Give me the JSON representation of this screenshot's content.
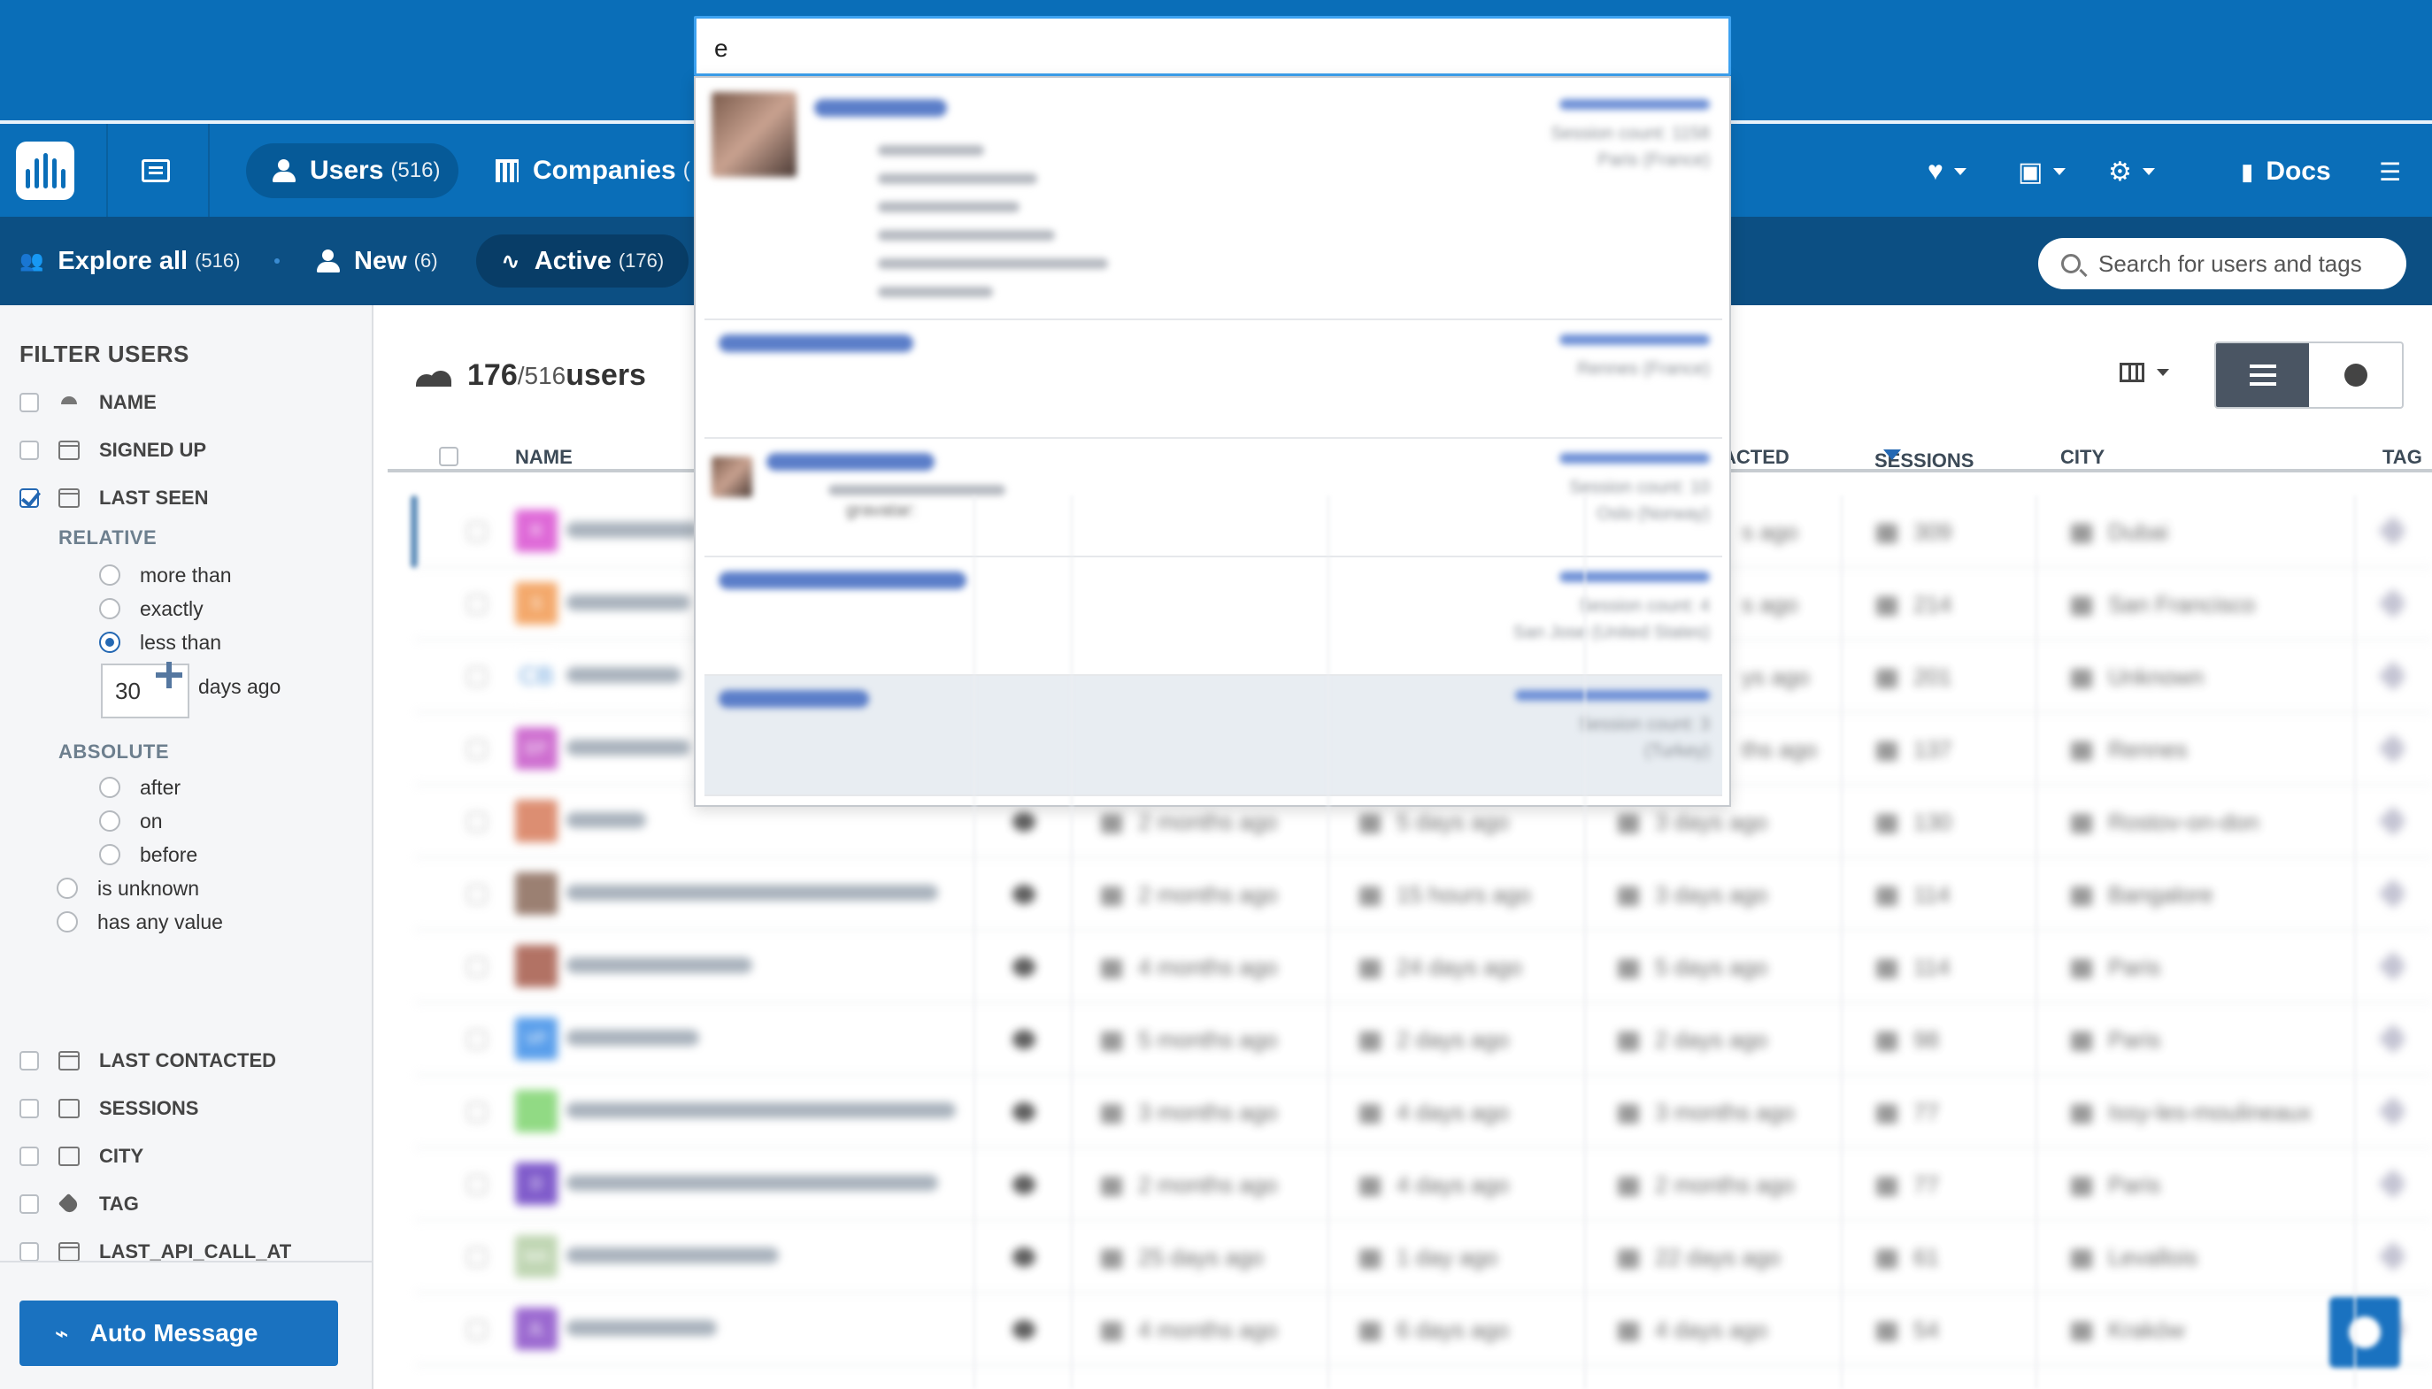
{
  "search": {
    "query": "e"
  },
  "nav": {
    "users_label": "Users",
    "users_count": "(516)",
    "companies_label": "Companies",
    "companies_count": "(",
    "docs_label": "Docs"
  },
  "subnav": {
    "explore_label": "Explore all",
    "explore_count": "(516)",
    "new_label": "New",
    "new_count": "(6)",
    "active_label": "Active",
    "active_count": "(176)",
    "search_placeholder": "Search for users and tags"
  },
  "sidebar": {
    "title": "FILTER USERS",
    "filters_top": [
      "NAME",
      "SIGNED UP",
      "LAST SEEN"
    ],
    "relative_label": "RELATIVE",
    "relative_options": [
      "more than",
      "exactly",
      "less than"
    ],
    "days_value": "30",
    "days_suffix": "days ago",
    "absolute_label": "ABSOLUTE",
    "absolute_options": [
      "after",
      "on",
      "before"
    ],
    "extra_options": [
      "is unknown",
      "has any value"
    ],
    "filters_bottom": [
      "LAST CONTACTED",
      "SESSIONS",
      "CITY",
      "TAG",
      "LAST_API_CALL_AT"
    ],
    "auto_message": "Auto Message"
  },
  "main": {
    "count_main": "176",
    "count_total": "/516",
    "count_suffix": " users",
    "columns": {
      "name": "NAME",
      "contacted": "ACTED",
      "sessions": "SESSIONS",
      "city": "CITY",
      "tag": "TAG"
    }
  },
  "rows": [
    {
      "av": "R",
      "avc": "#d94fd1",
      "c1": "",
      "c2": "",
      "c3": "s ago",
      "s": "309",
      "city": "Dubai"
    },
    {
      "av": "S",
      "avc": "#f29a52",
      "c1": "",
      "c2": "",
      "c3": "s ago",
      "s": "214",
      "city": "San Francisco"
    },
    {
      "av": "CB",
      "avc": "#ffffff",
      "c1": "",
      "c2": "",
      "c3": "ys ago",
      "s": "201",
      "city": "Unknown"
    },
    {
      "av": "EP",
      "avc": "#c656c8",
      "c1": "",
      "c2": "",
      "c3": "ths ago",
      "s": "137",
      "city": "Rennes"
    },
    {
      "av": "",
      "avc": "#d77b5a",
      "c1": "2 months ago",
      "c2": "5 days ago",
      "c3": "3 days ago",
      "s": "130",
      "city": "Rostov-on-don"
    },
    {
      "av": "",
      "avc": "#8a6a5a",
      "c1": "2 months ago",
      "c2": "15 hours ago",
      "c3": "3 days ago",
      "s": "114",
      "city": "Bangalore"
    },
    {
      "av": "",
      "avc": "#a55a4a",
      "c1": "4 months ago",
      "c2": "24 days ago",
      "c3": "5 days ago",
      "s": "114",
      "city": "Paris"
    },
    {
      "av": "VP",
      "avc": "#3d8ee8",
      "c1": "5 months ago",
      "c2": "2 days ago",
      "c3": "2 days ago",
      "s": "98",
      "city": "Paris"
    },
    {
      "av": "",
      "avc": "#7ed46f",
      "c1": "3 months ago",
      "c2": "4 days ago",
      "c3": "3 months ago",
      "s": "77",
      "city": "Issy-les-moulineaux"
    },
    {
      "av": "D",
      "avc": "#6a3fc2",
      "c1": "2 months ago",
      "c2": "4 days ago",
      "c3": "2 months ago",
      "s": "77",
      "city": "Paris"
    },
    {
      "av": "MA",
      "avc": "#b5cfa6",
      "c1": "25 days ago",
      "c2": "1 day ago",
      "c3": "22 days ago",
      "s": "61",
      "city": "Levallois"
    },
    {
      "av": "JL",
      "avc": "#8a4fc8",
      "c1": "4 months ago",
      "c2": "6 days ago",
      "c3": "4 days ago",
      "s": "54",
      "city": "Kraków"
    }
  ],
  "dropdown": [
    {
      "meta": [
        "Session count: 1158",
        "Paris (France)"
      ],
      "sub": 6
    },
    {
      "meta": [
        "Rennes (France)"
      ],
      "sub": 0
    },
    {
      "meta": [
        "Session count: 10",
        "Oslo (Norway)"
      ],
      "sub": 1,
      "sub_text": "gravatar:"
    },
    {
      "meta": [
        "Session count: 4",
        "San Jose (United States)"
      ],
      "sub": 0
    },
    {
      "meta": [
        "Session count: 3",
        "(Turkey)"
      ],
      "sub": 0
    }
  ]
}
